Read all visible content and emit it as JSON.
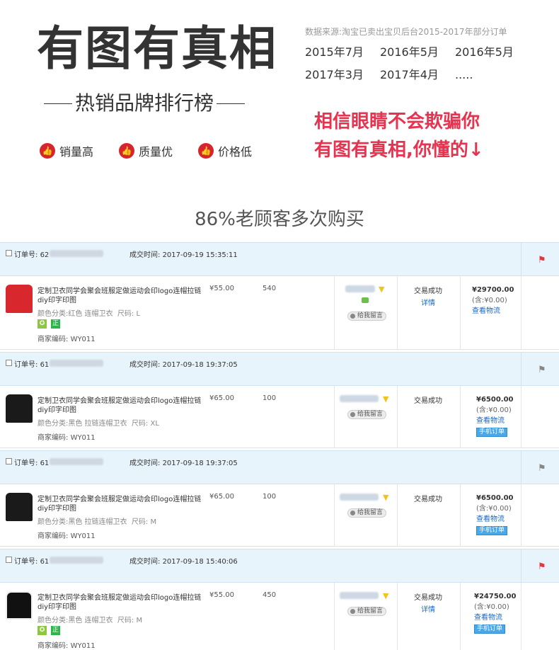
{
  "header": {
    "title": "有图有真相",
    "subtitle": "热销品牌排行榜",
    "badges": [
      "销量高",
      "质量优",
      "价格低"
    ],
    "source": "数据来源:淘宝已卖出宝贝后台2015-2017年部分订单",
    "months": [
      "2015年7月",
      "2016年5月",
      "2016年5月",
      "2017年3月",
      "2017年4月",
      "....."
    ],
    "slogan_line1": "相信眼睛不会欺骗你",
    "slogan_line2": "有图有真相,你懂的↓"
  },
  "section_title": "86%老顾客多次购买",
  "labels": {
    "order_no": "订单号:",
    "deal_time": "成交时间:",
    "color_class": "颜色分类:",
    "size": "尺码:",
    "merchant_code": "商家编码:",
    "leave_msg": "给我留言",
    "status": "交易成功",
    "detail": "详情",
    "tax": "(含:¥0.00)",
    "logistics": "查看物流",
    "mobile_order": "手机订单",
    "tag_correct": "正"
  },
  "orders": [
    {
      "order_prefix": "62",
      "time": "2017-09-19 15:35:11",
      "product": "定制卫衣同学会聚会班服定做运动会印logo连帽拉链diy印字印图",
      "color": "红色 连帽卫衣",
      "size": "L",
      "code": "WY011",
      "price": "¥55.00",
      "qty": "540",
      "status": "交易成功",
      "amount": "¥29700.00",
      "flag": "red"
    },
    {
      "order_prefix": "61",
      "time": "2017-09-18 19:37:05",
      "product": "定制卫衣同学会聚会班服定做运动会印logo连帽拉链diy印字印图",
      "color": "黑色 拉链连帽卫衣",
      "size": "XL",
      "code": "WY011",
      "price": "¥65.00",
      "qty": "100",
      "status": "交易成功",
      "amount": "¥6500.00",
      "flag": "gray"
    },
    {
      "order_prefix": "61",
      "time": "2017-09-18 19:37:05",
      "product": "定制卫衣同学会聚会班服定做运动会印logo连帽拉链diy印字印图",
      "color": "黑色 拉链连帽卫衣",
      "size": "M",
      "code": "WY011",
      "price": "¥65.00",
      "qty": "100",
      "status": "交易成功",
      "amount": "¥6500.00",
      "flag": "gray"
    },
    {
      "order_prefix": "61",
      "time": "2017-09-18 15:40:06",
      "product": "定制卫衣同学会聚会班服定做运动会印logo连帽拉链diy印字印图",
      "color": "黑色 连帽卫衣",
      "size": "M",
      "code": "WY011",
      "price": "¥55.00",
      "qty": "450",
      "status": "交易成功",
      "amount": "¥24750.00",
      "flag": "red"
    }
  ]
}
